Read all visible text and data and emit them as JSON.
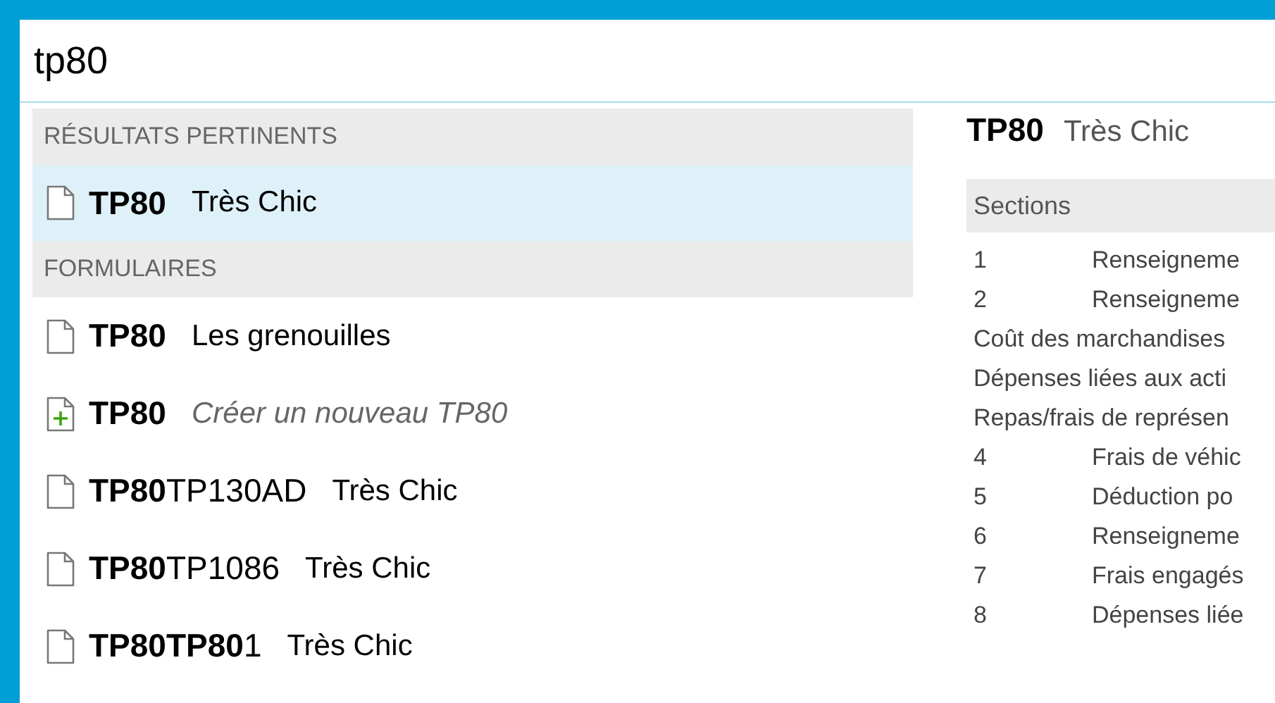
{
  "search": {
    "value": "tp80"
  },
  "results": [
    {
      "heading": "RÉSULTATS PERTINENTS",
      "items": [
        {
          "kind": "document",
          "code": "**TP80**",
          "title": "Très Chic",
          "selected": true
        }
      ]
    },
    {
      "heading": "FORMULAIRES",
      "items": [
        {
          "kind": "document",
          "code": "**TP80**",
          "title": "Les grenouilles",
          "selected": false
        },
        {
          "kind": "new",
          "code": "**TP80**",
          "title": "Créer un nouveau TP80",
          "selected": false
        },
        {
          "kind": "document",
          "code": "**TP80**TP130AD",
          "title": "Très Chic",
          "selected": false
        },
        {
          "kind": "document",
          "code": "**TP80**TP1086",
          "title": "Très Chic",
          "selected": false
        },
        {
          "kind": "document",
          "code": "**TP80TP80**1",
          "title": "Très Chic",
          "selected": false
        }
      ]
    }
  ],
  "preview": {
    "code": "TP80",
    "title": "Très Chic",
    "sections_heading": "Sections",
    "sections": [
      {
        "number": "1",
        "label": "Renseigneme"
      },
      {
        "number": "2",
        "label": "Renseigneme"
      },
      {
        "label": "Coût des marchandises"
      },
      {
        "label": "Dépenses liées aux acti"
      },
      {
        "label": "Repas/frais de représen"
      },
      {
        "number": "4",
        "label": "Frais de véhic"
      },
      {
        "number": "5",
        "label": "Déduction po"
      },
      {
        "number": "6",
        "label": "Renseigneme"
      },
      {
        "number": "7",
        "label": "Frais engagés"
      },
      {
        "number": "8",
        "label": "Dépenses liée"
      }
    ]
  }
}
